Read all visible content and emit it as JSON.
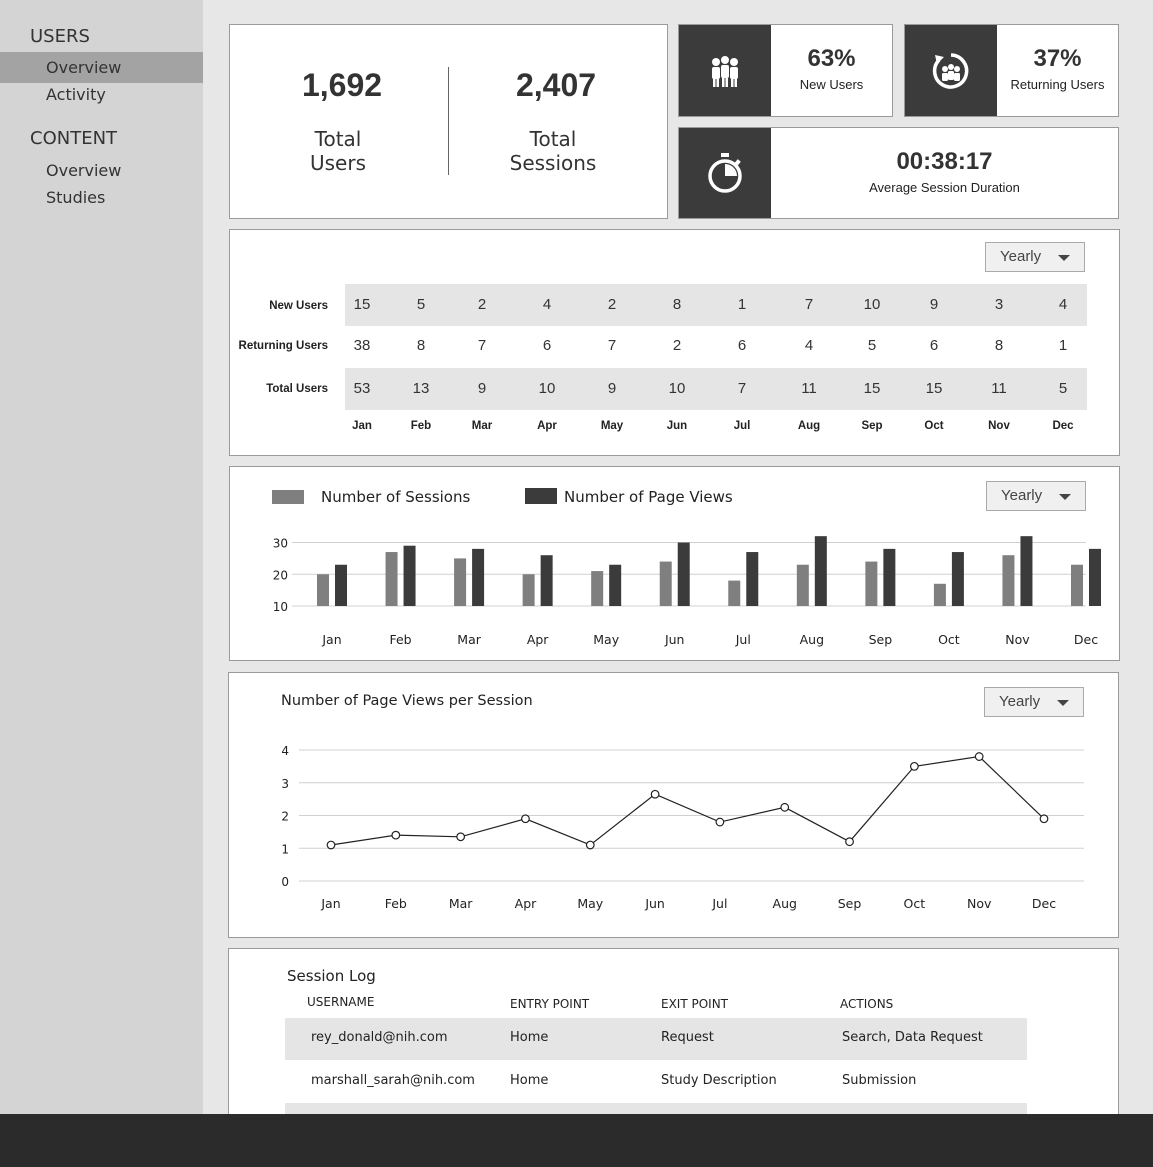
{
  "sidebar": {
    "sections": [
      {
        "heading": "USERS",
        "items": [
          {
            "label": "Overview",
            "active": true
          },
          {
            "label": "Activity",
            "active": false
          }
        ]
      },
      {
        "heading": "CONTENT",
        "items": [
          {
            "label": "Overview",
            "active": false
          },
          {
            "label": "Studies",
            "active": false
          }
        ]
      }
    ]
  },
  "totals": {
    "users_value": "1,692",
    "users_label_1": "Total",
    "users_label_2": "Users",
    "sessions_value": "2,407",
    "sessions_label_1": "Total",
    "sessions_label_2": "Sessions"
  },
  "stats": {
    "new_users": {
      "value": "63%",
      "label": "New Users",
      "icon": "group-icon"
    },
    "returning_users": {
      "value": "37%",
      "label": "Returning Users",
      "icon": "returning-users-icon"
    },
    "session_duration": {
      "value": "00:38:17",
      "label": "Average Session Duration",
      "icon": "stopwatch-icon"
    }
  },
  "users_table": {
    "period": "Yearly",
    "months": [
      "Jan",
      "Feb",
      "Mar",
      "Apr",
      "May",
      "Jun",
      "Jul",
      "Aug",
      "Sep",
      "Oct",
      "Nov",
      "Dec"
    ],
    "rows": [
      {
        "label": "New Users",
        "values": [
          "15",
          "5",
          "2",
          "4",
          "2",
          "8",
          "1",
          "7",
          "10",
          "9",
          "3",
          "4"
        ]
      },
      {
        "label": "Returning Users",
        "values": [
          "38",
          "8",
          "7",
          "6",
          "7",
          "2",
          "6",
          "4",
          "5",
          "6",
          "8",
          "1"
        ]
      },
      {
        "label": "Total Users",
        "values": [
          "53",
          "13",
          "9",
          "10",
          "9",
          "10",
          "7",
          "11",
          "15",
          "15",
          "11",
          "5"
        ]
      }
    ]
  },
  "sessions_chart": {
    "period": "Yearly",
    "colors": {
      "sessions": "#7f7f7f",
      "page_views": "#3b3b3b"
    },
    "chart_data": {
      "type": "bar",
      "categories": [
        "Jan",
        "Feb",
        "Mar",
        "Apr",
        "May",
        "Jun",
        "Jul",
        "Aug",
        "Sep",
        "Oct",
        "Nov",
        "Dec"
      ],
      "series": [
        {
          "name": "Number of Sessions",
          "values": [
            20,
            27,
            25,
            20,
            21,
            24,
            18,
            23,
            24,
            17,
            26,
            23
          ]
        },
        {
          "name": "Number of Page Views",
          "values": [
            23,
            29,
            28,
            26,
            23,
            30,
            27,
            32,
            28,
            27,
            32,
            28
          ]
        }
      ],
      "yticks": [
        "10",
        "20",
        "30"
      ],
      "ylim": [
        10,
        33
      ],
      "grid": true,
      "legend": "top-left"
    }
  },
  "pageviews_chart": {
    "title": "Number of Page Views per Session",
    "period": "Yearly",
    "chart_data": {
      "type": "line",
      "categories": [
        "Jan",
        "Feb",
        "Mar",
        "Apr",
        "May",
        "Jun",
        "Jul",
        "Aug",
        "Sep",
        "Oct",
        "Nov",
        "Dec"
      ],
      "values": [
        1.1,
        1.4,
        1.35,
        1.9,
        1.1,
        2.65,
        1.8,
        2.25,
        1.2,
        3.5,
        3.8,
        1.9
      ],
      "yticks": [
        "0",
        "1",
        "2",
        "3",
        "4"
      ],
      "ylim": [
        0,
        4
      ],
      "grid": true
    }
  },
  "session_log": {
    "title": "Session Log",
    "headers": [
      "USERNAME",
      "ENTRY POINT",
      "EXIT POINT",
      "ACTIONS"
    ],
    "rows": [
      [
        "rey_donald@nih.com",
        "Home",
        "Request",
        "Search, Data Request"
      ],
      [
        "marshall_sarah@nih.com",
        "Home",
        "Study Description",
        "Submission"
      ]
    ]
  }
}
